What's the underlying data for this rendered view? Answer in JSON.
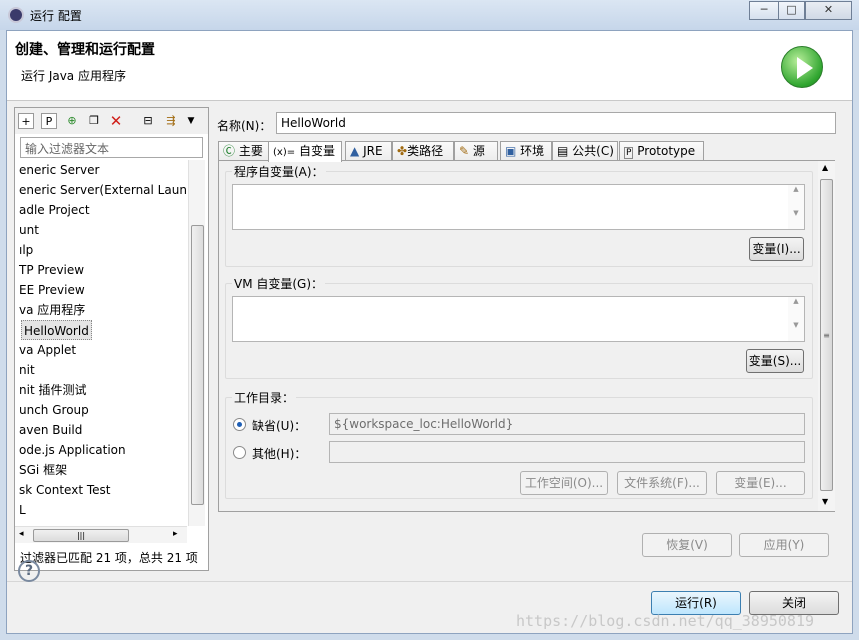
{
  "window": {
    "title": "运行 配置",
    "min": "─",
    "max": "□",
    "close": "✕"
  },
  "header": {
    "title": "创建、管理和运行配置",
    "subtitle": "运行 Java 应用程序"
  },
  "left": {
    "filter_placeholder": "输入过滤器文本",
    "toolbar_icons": [
      "new-config-icon",
      "new-prototype-icon",
      "duplicate-icon",
      "copy-icon",
      "delete-icon",
      "collapse-all-icon",
      "filter-icon",
      "view-menu-icon"
    ],
    "items": [
      "eneric Server",
      "eneric Server(External Launch",
      "adle Project",
      "unt",
      "ılp",
      "TP Preview",
      "EE Preview",
      "va 应用程序",
      "HelloWorld",
      "va Applet",
      "nit",
      "nit 插件测试",
      "unch Group",
      "aven Build",
      "ode.js Application",
      "SGi 框架",
      "sk Context Test",
      "L"
    ],
    "selected_index": 8,
    "status": "过滤器已匹配 21 项，总共 21 项"
  },
  "right": {
    "name_label": "名称(N)：",
    "name_value": "HelloWorld",
    "tabs": [
      "主要",
      "自变量",
      "JRE",
      "类路径",
      "源",
      "环境",
      "公共(C)",
      "Prototype"
    ],
    "active_tab": 1,
    "program_args_label": "程序自变量(A)：",
    "program_vars_btn": "变量(I)...",
    "vm_args_label": "VM 自变量(G)：",
    "vm_vars_btn": "变量(S)...",
    "workdir_label": "工作目录：",
    "default_radio": "缺省(U)：",
    "default_value": "${workspace_loc:HelloWorld}",
    "other_radio": "其他(H)：",
    "other_value": "",
    "workspace_btn": "工作空间(O)...",
    "filesystem_btn": "文件系统(F)...",
    "variables_btn": "变量(E)...",
    "revert_btn": "恢复(V)",
    "apply_btn": "应用(Y)"
  },
  "footer": {
    "run_btn": "运行(R)",
    "close_btn": "关闭",
    "help": "?"
  },
  "watermark": "https://blog.csdn.net/qq_38950819"
}
